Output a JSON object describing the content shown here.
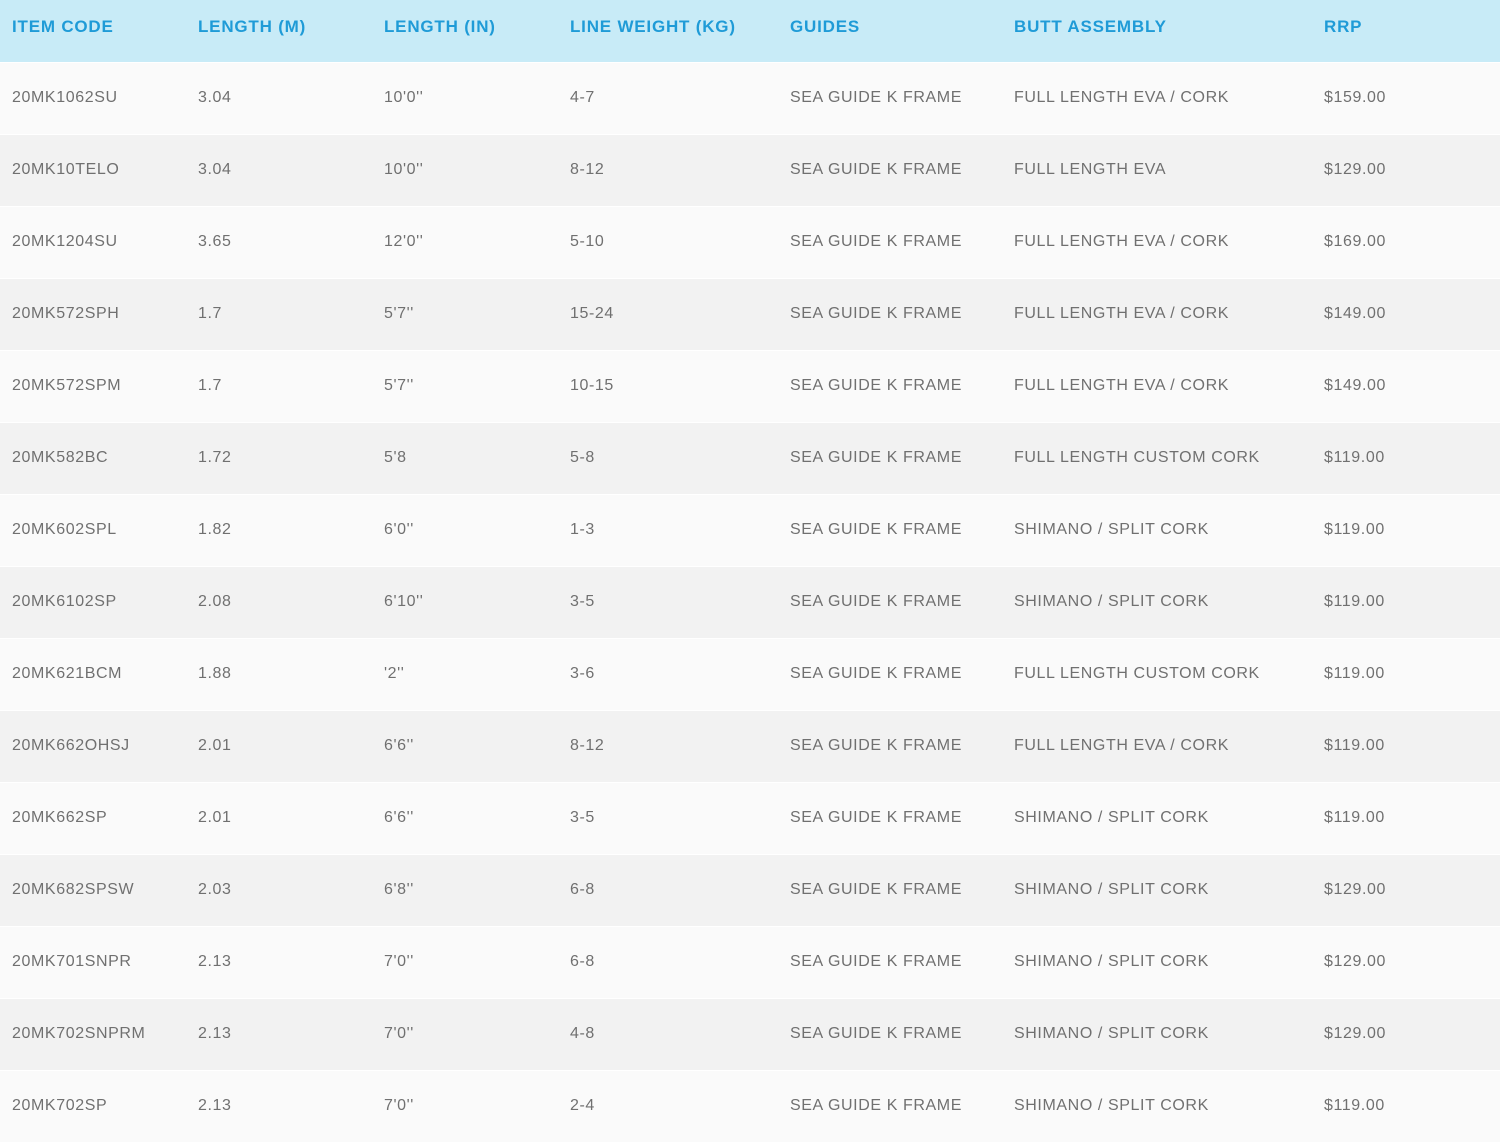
{
  "table": {
    "headers": [
      "ITEM CODE",
      "LENGTH (M)",
      "LENGTH (IN)",
      "LINE WEIGHT (KG)",
      "GUIDES",
      "BUTT ASSEMBLY",
      "RRP"
    ],
    "rows": [
      [
        "20MK1062SU",
        "3.04",
        "10'0''",
        "4-7",
        "SEA GUIDE K FRAME",
        "FULL LENGTH EVA / CORK",
        "$159.00"
      ],
      [
        "20MK10TELO",
        "3.04",
        "10'0''",
        "8-12",
        "SEA GUIDE K FRAME",
        "FULL LENGTH EVA",
        "$129.00"
      ],
      [
        "20MK1204SU",
        "3.65",
        "12'0''",
        "5-10",
        "SEA GUIDE K FRAME",
        "FULL LENGTH EVA / CORK",
        "$169.00"
      ],
      [
        "20MK572SPH",
        "1.7",
        "5'7''",
        "15-24",
        "SEA GUIDE K FRAME",
        "FULL LENGTH EVA / CORK",
        "$149.00"
      ],
      [
        "20MK572SPM",
        "1.7",
        "5'7''",
        "10-15",
        "SEA GUIDE K FRAME",
        "FULL LENGTH EVA / CORK",
        "$149.00"
      ],
      [
        "20MK582BC",
        "1.72",
        "5'8",
        "5-8",
        "SEA GUIDE K FRAME",
        "FULL LENGTH CUSTOM CORK",
        "$119.00"
      ],
      [
        "20MK602SPL",
        "1.82",
        "6'0''",
        "1-3",
        "SEA GUIDE K FRAME",
        "SHIMANO / SPLIT CORK",
        "$119.00"
      ],
      [
        "20MK6102SP",
        "2.08",
        "6'10''",
        "3-5",
        "SEA GUIDE K FRAME",
        "SHIMANO / SPLIT CORK",
        "$119.00"
      ],
      [
        "20MK621BCM",
        "1.88",
        "'2''",
        "3-6",
        "SEA GUIDE K FRAME",
        "FULL LENGTH CUSTOM CORK",
        "$119.00"
      ],
      [
        "20MK662OHSJ",
        "2.01",
        "6'6''",
        "8-12",
        "SEA GUIDE K FRAME",
        "FULL LENGTH EVA / CORK",
        "$119.00"
      ],
      [
        "20MK662SP",
        "2.01",
        "6'6''",
        "3-5",
        "SEA GUIDE K FRAME",
        "SHIMANO / SPLIT CORK",
        "$119.00"
      ],
      [
        "20MK682SPSW",
        "2.03",
        "6'8''",
        "6-8",
        "SEA GUIDE K FRAME",
        "SHIMANO / SPLIT CORK",
        "$129.00"
      ],
      [
        "20MK701SNPR",
        "2.13",
        "7'0''",
        "6-8",
        "SEA GUIDE K FRAME",
        "SHIMANO / SPLIT CORK",
        "$129.00"
      ],
      [
        "20MK702SNPRM",
        "2.13",
        "7'0''",
        "4-8",
        "SEA GUIDE K FRAME",
        "SHIMANO / SPLIT CORK",
        "$129.00"
      ],
      [
        "20MK702SP",
        "2.13",
        "7'0''",
        "2-4",
        "SEA GUIDE K FRAME",
        "SHIMANO / SPLIT CORK",
        "$119.00"
      ]
    ]
  },
  "colors": {
    "header_bg": "#c8ebf7",
    "header_text": "#1f9bd7",
    "row_odd": "#fafafa",
    "row_even": "#f2f2f2",
    "cell_text": "#707070"
  }
}
